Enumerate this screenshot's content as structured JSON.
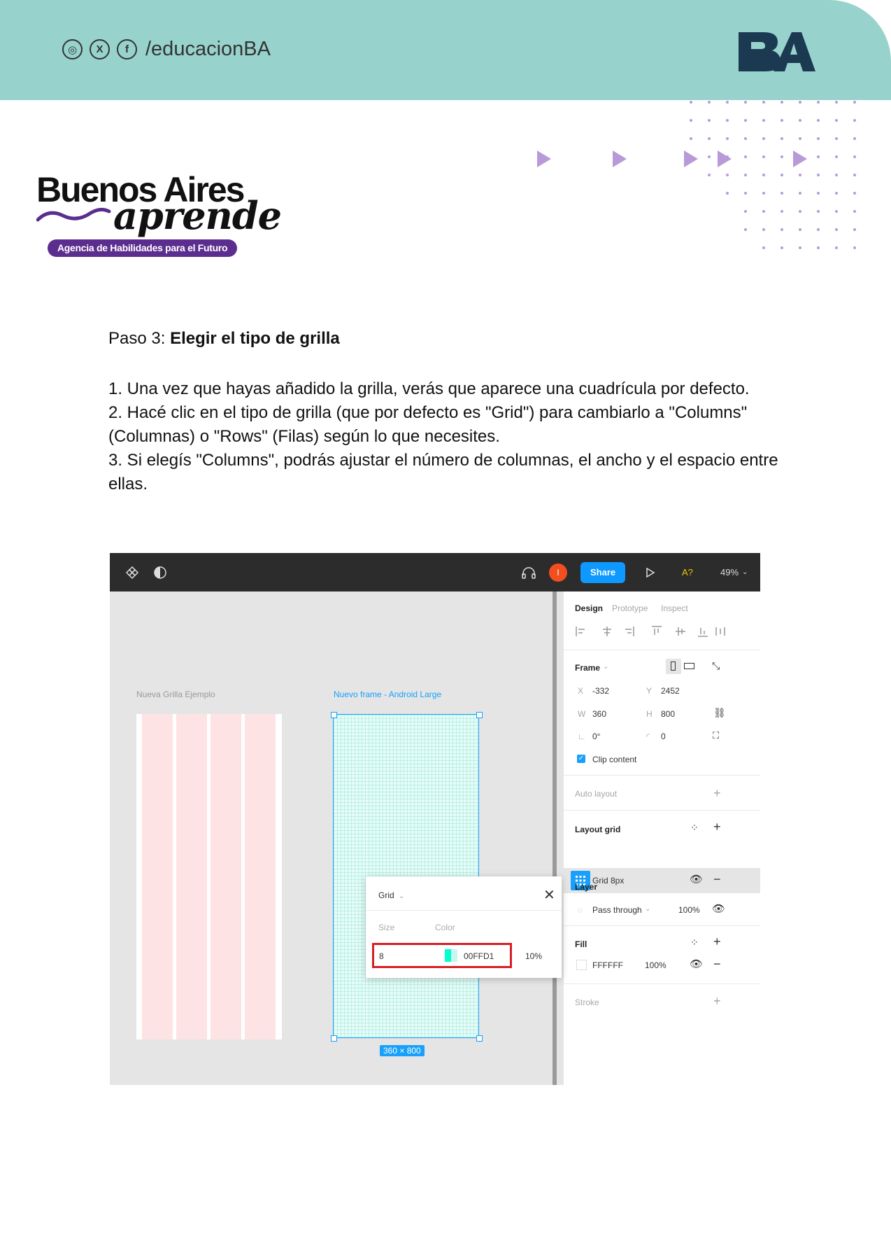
{
  "header": {
    "social_handle": "/educacionBA",
    "social_icons": [
      "instagram-icon",
      "x-icon",
      "facebook-icon"
    ],
    "logo_text": "BA",
    "band_color": "#97d3cc"
  },
  "brand": {
    "line1": "Buenos Aires",
    "line2": "aprende",
    "tagline": "Agencia de Habilidades para el Futuro",
    "accent": "#5b2d8e"
  },
  "content": {
    "step_prefix": "Paso 3: ",
    "step_title": "Elegir el tipo de grilla",
    "items": [
      "1. Una vez que hayas añadido la grilla, verás que aparece una cuadrícula por defecto.",
      "2. Hacé clic en el tipo de grilla (que por defecto es \"Grid\") para cambiarlo a \"Columns\" (Columnas) o \"Rows\" (Filas) según lo que necesites.",
      "3. Si elegís \"Columns\", podrás ajustar el número de columnas, el ancho y el espacio entre ellas."
    ]
  },
  "screenshot": {
    "toolbar": {
      "avatar_initial": "I",
      "share_label": "Share",
      "font_label": "A?",
      "zoom": "49%"
    },
    "canvas": {
      "frame1_label": "Nueva Grilla Ejemplo",
      "frame2_label": "Nuevo frame - Android Large",
      "size_tag": "360 × 800"
    },
    "panel": {
      "tabs": [
        "Design",
        "Prototype",
        "Inspect"
      ],
      "frame_label": "Frame",
      "x_label": "X",
      "x_value": "-332",
      "y_label": "Y",
      "y_value": "2452",
      "w_label": "W",
      "w_value": "360",
      "h_label": "H",
      "h_value": "800",
      "rotation": "0°",
      "radius": "0",
      "clip_content": "Clip content",
      "auto_layout": "Auto layout",
      "layout_grid": "Layout grid",
      "grid_item": "Grid 8px",
      "layer": "Layer",
      "blend_mode": "Pass through",
      "layer_opacity": "100%",
      "fill": "Fill",
      "fill_color": "FFFFFF",
      "fill_opacity": "100%",
      "stroke": "Stroke"
    },
    "popup": {
      "type": "Grid",
      "size_label": "Size",
      "color_label": "Color",
      "size_value": "8",
      "color_value": "00FFD1",
      "opacity": "10%",
      "grid_color": "#00ffd1",
      "highlight_color": "#d71f26"
    }
  }
}
